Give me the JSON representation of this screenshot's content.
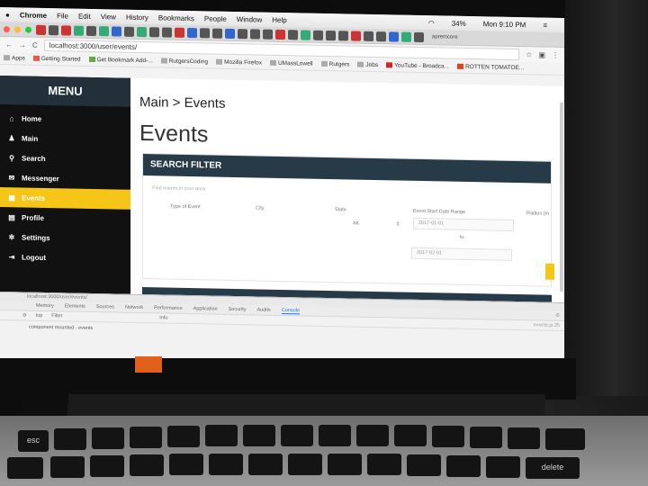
{
  "macbar": {
    "app": "Chrome",
    "menus": [
      "File",
      "Edit",
      "View",
      "History",
      "Bookmarks",
      "People",
      "Window",
      "Help"
    ],
    "battery": "34%",
    "clock": "Mon 9:10 PM"
  },
  "browser": {
    "url": "localhost:3000/user/events/",
    "profile": "apremcore",
    "bookmarks": [
      "Apps",
      "Getting Started",
      "Get Bookmark Add-...",
      "RutgersCoding",
      "Mozilla Firefox",
      "UMassLowell",
      "Rutgers",
      "Jobs",
      "YouTube - Broadca...",
      "ROTTEN TOMATOE..."
    ]
  },
  "sidebar": {
    "header": "MENU",
    "items": [
      {
        "label": "Home",
        "icon": "home-icon",
        "glyph": "⌂"
      },
      {
        "label": "Main",
        "icon": "user-icon",
        "glyph": "♟"
      },
      {
        "label": "Search",
        "icon": "search-icon",
        "glyph": "⚲"
      },
      {
        "label": "Messenger",
        "icon": "chat-icon",
        "glyph": "✉"
      },
      {
        "label": "Events",
        "icon": "calendar-icon",
        "glyph": "▦"
      },
      {
        "label": "Profile",
        "icon": "id-card-icon",
        "glyph": "▤"
      },
      {
        "label": "Settings",
        "icon": "gear-icon",
        "glyph": "✲"
      },
      {
        "label": "Logout",
        "icon": "logout-icon",
        "glyph": "⇥"
      }
    ]
  },
  "main": {
    "breadcrumb": "Main > Events",
    "title": "Events",
    "panel": {
      "header": "SEARCH FILTER",
      "subtitle": "Find events in your area",
      "labels": {
        "type": "Type of Event",
        "city": "City",
        "state": "State",
        "date_range": "Event Start Date Range",
        "radius": "Radius (m"
      },
      "state_value": "AK",
      "date_start": "2017-01-01",
      "date_to": "to",
      "date_end": "2017-02-01"
    }
  },
  "devtools": {
    "url": "localhost:3000/user/events/",
    "tabs": [
      "Memory",
      "Elements",
      "Sources",
      "Network",
      "Performance",
      "Application",
      "Security",
      "Audits",
      "Console"
    ],
    "context": "top",
    "filter_placeholder": "Filter",
    "level": "Info",
    "log": "component mounted - events",
    "source": "events.js:25"
  },
  "colors": {
    "sidebar_bg": "#111111",
    "menu_header": "#22303a",
    "active_item": "#f5c518",
    "panel_header": "#263a47"
  }
}
